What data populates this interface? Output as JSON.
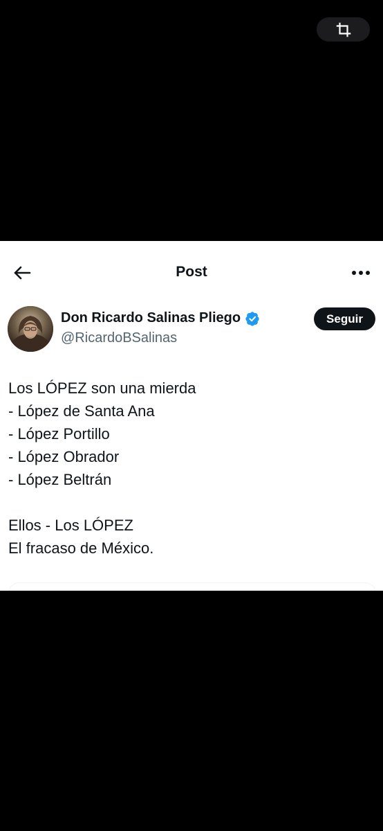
{
  "overlay": {
    "crop_icon": "crop-icon"
  },
  "header": {
    "back_icon": "arrow-left-icon",
    "title": "Post",
    "more_icon": "more-horizontal-icon"
  },
  "author": {
    "display_name": "Don Ricardo Salinas Pliego",
    "verified": true,
    "verified_color": "#1d9bf0",
    "handle": "@RicardoBSalinas",
    "follow_label": "Seguir"
  },
  "post": {
    "lines": [
      "Los LÓPEZ son una mierda",
      "- López de Santa Ana",
      "- López Portillo",
      "- López Obrador",
      "- López Beltrán",
      "",
      "Ellos - Los LÓPEZ",
      "El fracaso de México."
    ]
  },
  "colors": {
    "background": "#000000",
    "card": "#ffffff",
    "text_primary": "#0f1419",
    "text_secondary": "#536471",
    "button_dark": "#0f1419"
  }
}
